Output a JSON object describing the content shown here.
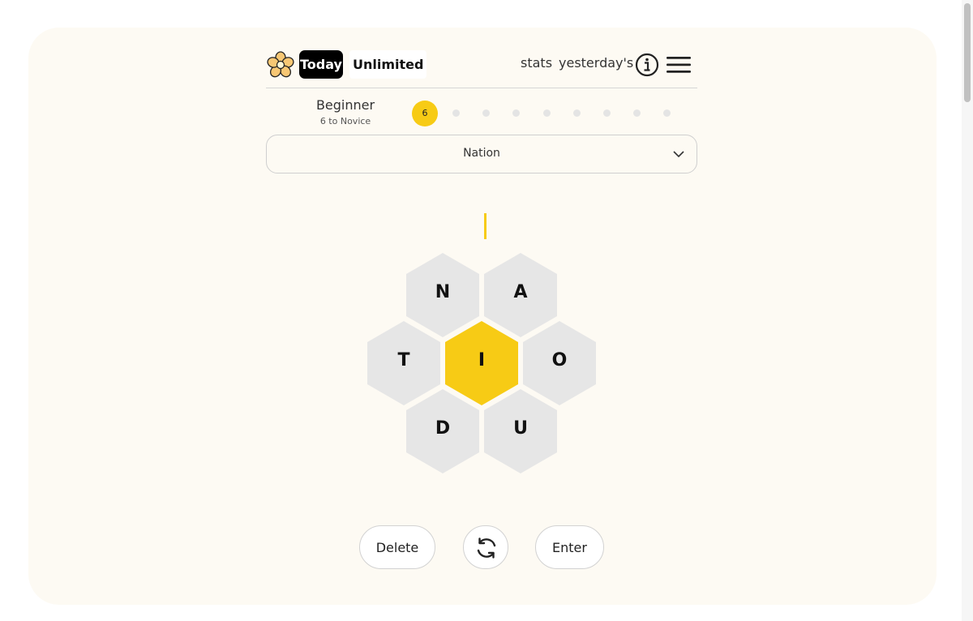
{
  "header": {
    "tabs": [
      {
        "label": "Today",
        "active": true
      },
      {
        "label": "Unlimited",
        "active": false
      }
    ],
    "links": {
      "stats": "stats",
      "yesterday": "yesterday's"
    },
    "icons": [
      "flower-logo-icon",
      "info-icon",
      "hamburger-menu-icon"
    ]
  },
  "rank": {
    "title": "Beginner",
    "subtitle": "6 to Novice",
    "score": "6",
    "total_levels": 9,
    "current_level": 1
  },
  "puzzle_select": {
    "value": "Nation"
  },
  "hive": {
    "center": "I",
    "outer": {
      "top_left": "N",
      "top_right": "A",
      "left": "T",
      "right": "O",
      "bottom_left": "D",
      "bottom_right": "U"
    }
  },
  "controls": {
    "delete": "Delete",
    "enter": "Enter",
    "shuffle_icon": "refresh-icon"
  },
  "colors": {
    "accent": "#f7cb15",
    "card_background": "#fdfaf3",
    "hex_inactive": "#e6e6e6"
  }
}
